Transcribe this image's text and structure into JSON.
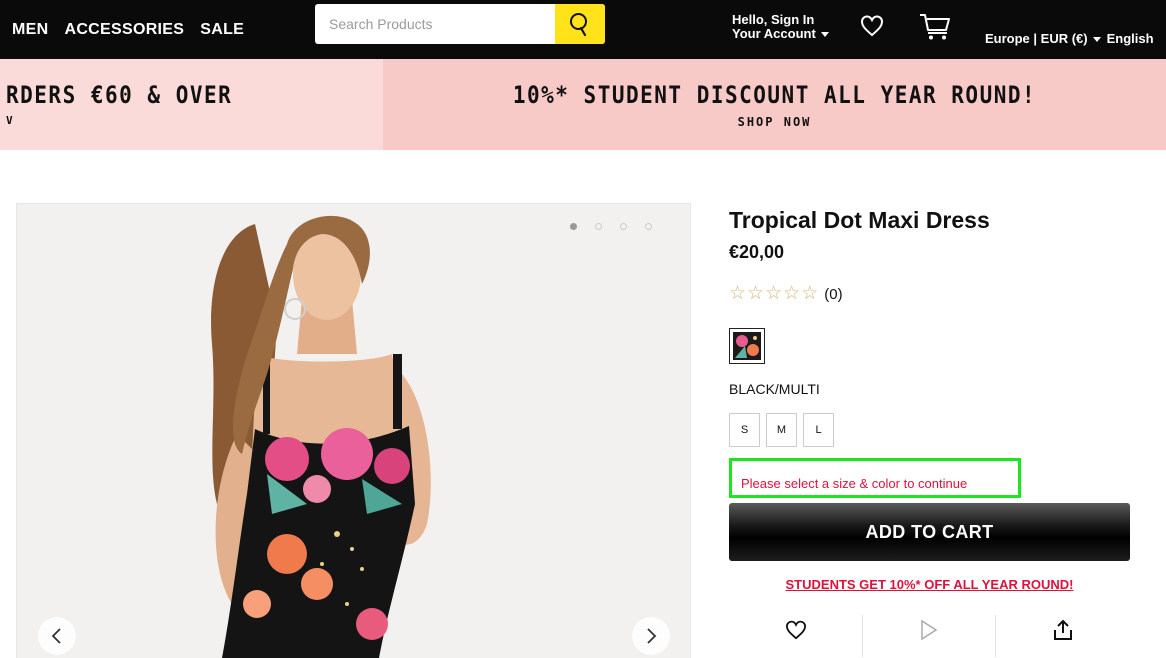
{
  "nav": {
    "links": [
      "MEN",
      "ACCESSORIES",
      "SALE"
    ],
    "search_placeholder": "Search Products",
    "account_line1": "Hello, Sign In",
    "account_line2": "Your Account",
    "locale": "Europe | EUR (€)",
    "language": "English"
  },
  "promos": {
    "left_text": "RDERS €60 & OVER",
    "left_sub": "V",
    "right_text": "10%* STUDENT DISCOUNT ALL YEAR ROUND!",
    "right_sub": "SHOP NOW"
  },
  "gallery": {
    "image_count": 4,
    "active_index": 0
  },
  "product": {
    "title": "Tropical Dot Maxi Dress",
    "price": "€20,00",
    "rating_stars": 0,
    "review_count": "(0)",
    "color_name": "BLACK/MULTI",
    "sizes": [
      "S",
      "M",
      "L"
    ],
    "error_message": "Please select a size & color to continue",
    "add_to_cart": "ADD TO CART",
    "student_link": "STUDENTS GET 10%* OFF ALL YEAR ROUND!"
  },
  "colors": {
    "nav_bg": "#0a0a0a",
    "search_button": "#ffe21a",
    "promo_left_bg": "#fbdada",
    "promo_right_bg": "#f7c9c7",
    "error_text": "#e0103a",
    "error_highlight": "#1ee61e",
    "star_outline": "#d7b47a"
  },
  "icons": [
    "search-icon",
    "heart-icon",
    "cart-icon",
    "chevron-left-icon",
    "chevron-right-icon",
    "play-icon",
    "share-icon"
  ]
}
